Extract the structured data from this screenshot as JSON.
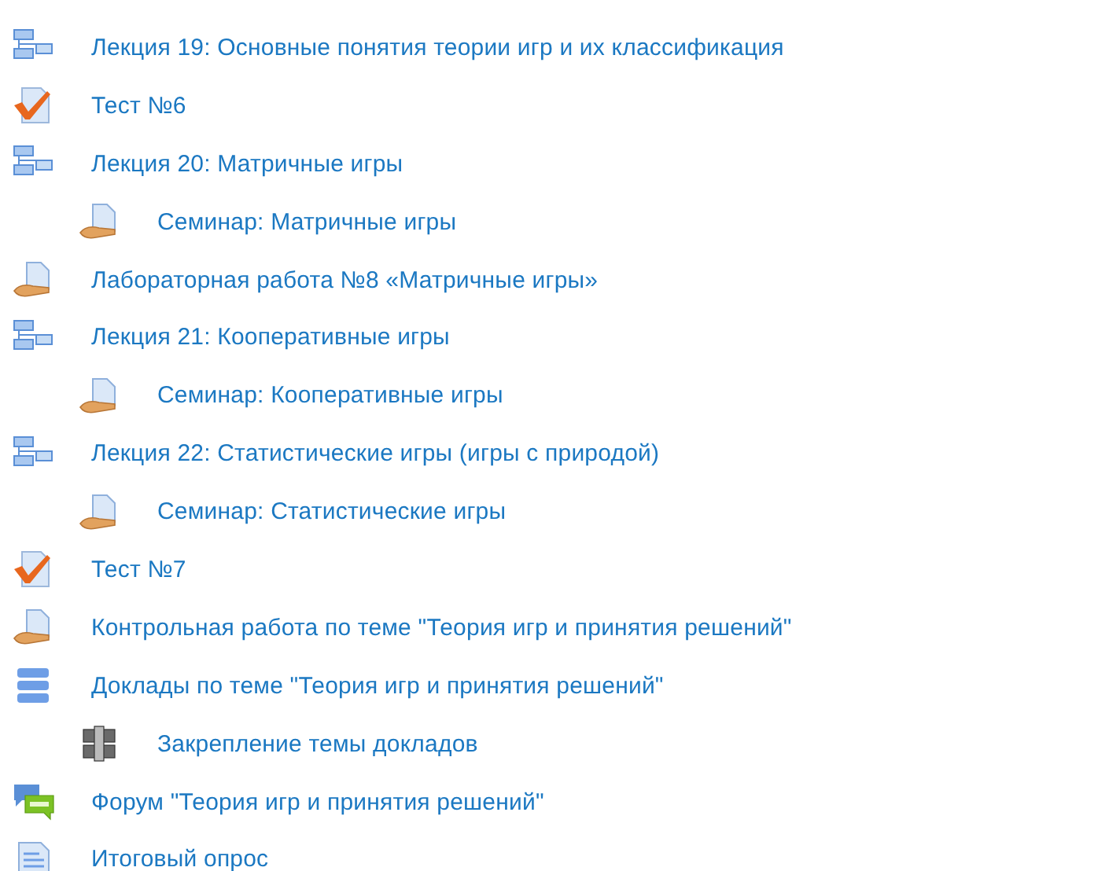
{
  "items": [
    {
      "kind": "lesson",
      "title": "Лекция 19: Основные понятия теории игр и их классификация"
    },
    {
      "kind": "quiz",
      "title": "Тест №6"
    },
    {
      "kind": "lesson",
      "title": "Лекция 20: Матричные игры",
      "children": [
        {
          "kind": "assignment",
          "title": "Семинар: Матричные игры"
        }
      ]
    },
    {
      "kind": "assignment",
      "title": "Лабораторная работа №8 «Матричные игры»"
    },
    {
      "kind": "lesson",
      "title": "Лекция 21: Кооперативные игры",
      "children": [
        {
          "kind": "assignment",
          "title": "Семинар: Кооперативные игры"
        }
      ]
    },
    {
      "kind": "lesson",
      "title": "Лекция 22: Статистические игры (игры с природой)",
      "children": [
        {
          "kind": "assignment",
          "title": "Семинар: Статистические игры"
        }
      ]
    },
    {
      "kind": "quiz",
      "title": "Тест №7"
    },
    {
      "kind": "assignment",
      "title": "Контрольная работа по теме \"Теория игр и принятия решений\""
    },
    {
      "kind": "database",
      "title": "Доклады по теме \"Теория игр и принятия решений\"",
      "children": [
        {
          "kind": "workshop",
          "title": "Закрепление темы докладов"
        }
      ]
    },
    {
      "kind": "forum",
      "title": "Форум \"Теория игр и принятия решений\""
    },
    {
      "kind": "feedback",
      "title": "Итоговый опрос"
    }
  ]
}
